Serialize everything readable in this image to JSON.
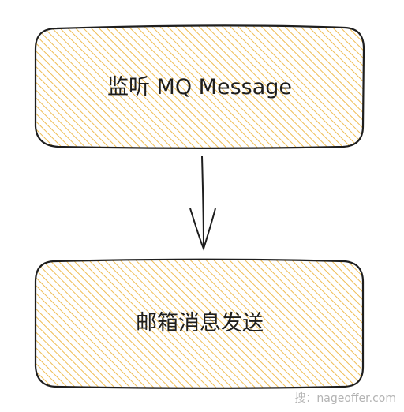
{
  "colors": {
    "fill": "#f4c862",
    "stroke": "#1e1e1e",
    "hatch": "#edb43f"
  },
  "nodes": [
    {
      "id": "listen",
      "label": "监听 MQ Message"
    },
    {
      "id": "send",
      "label": "邮箱消息发送"
    }
  ],
  "edges": [
    {
      "from": "listen",
      "to": "send"
    }
  ],
  "watermark": "搜：nageoffer.com"
}
